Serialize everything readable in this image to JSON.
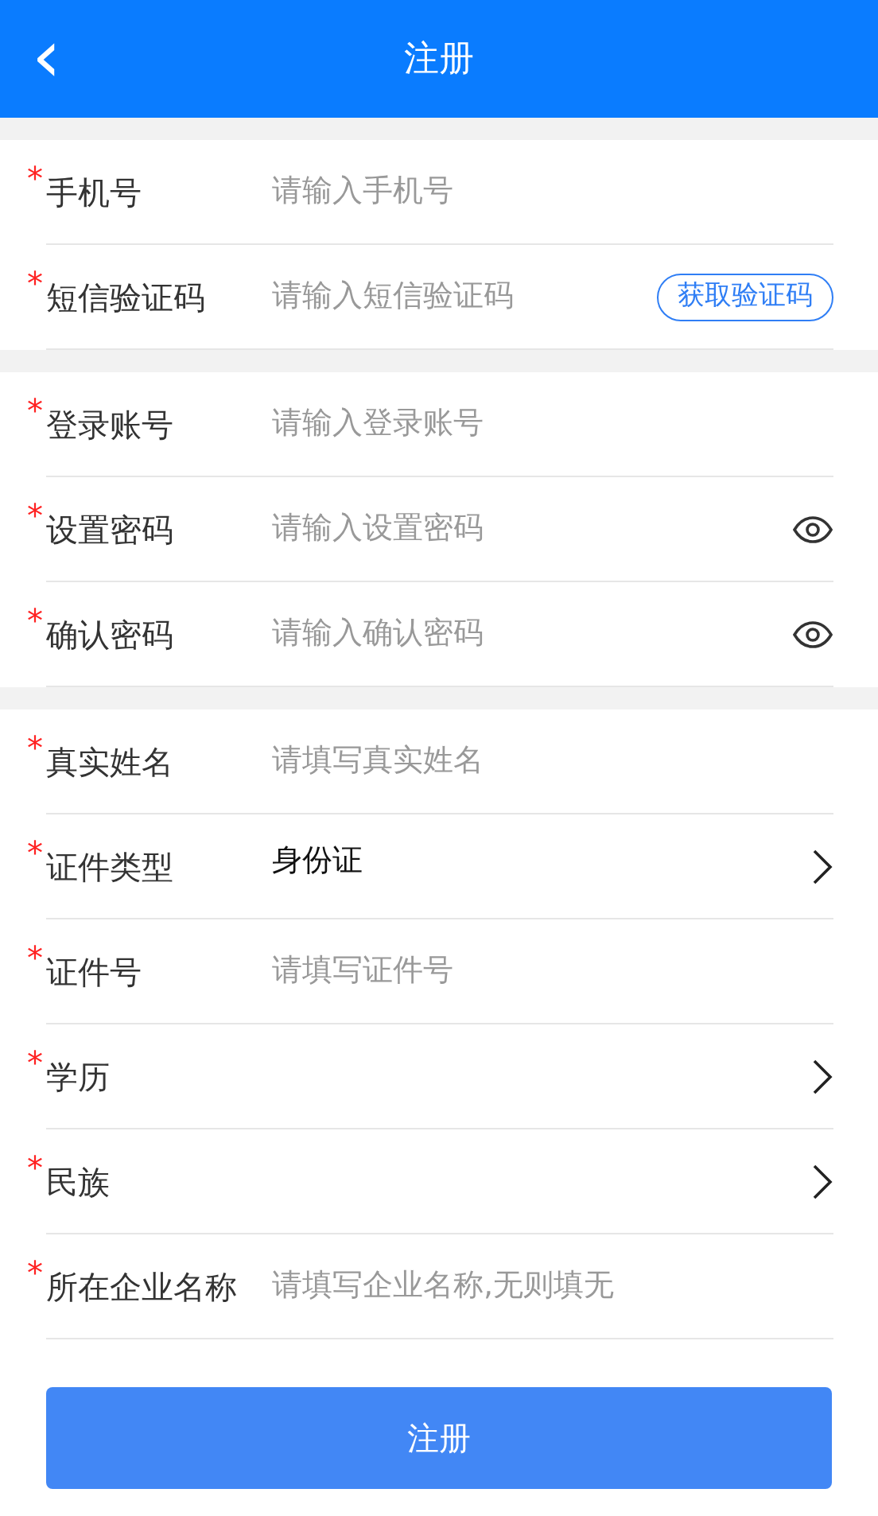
{
  "header": {
    "back": "‹",
    "title": "注册"
  },
  "sections": [
    {
      "rows": [
        {
          "kind": "input",
          "mark": "*",
          "label": "手机号",
          "placeholder": "请输入手机号"
        },
        {
          "kind": "code",
          "mark": "*",
          "label": "短信验证码",
          "placeholder": "请输入短信验证码",
          "button": "获取验证码"
        }
      ]
    },
    {
      "rows": [
        {
          "kind": "input",
          "mark": "*",
          "label": "登录账号",
          "placeholder": "请输入登录账号"
        },
        {
          "kind": "password",
          "mark": "*",
          "label": "设置密码",
          "placeholder": "请输入设置密码"
        },
        {
          "kind": "password",
          "mark": "*",
          "label": "确认密码",
          "placeholder": "请输入确认密码"
        }
      ]
    },
    {
      "rows": [
        {
          "kind": "input",
          "mark": "*",
          "label": "真实姓名",
          "placeholder": "请填写真实姓名"
        },
        {
          "kind": "select",
          "mark": "*",
          "label": "证件类型",
          "value": "身份证"
        },
        {
          "kind": "input",
          "mark": "*",
          "label": "证件号",
          "placeholder": "请填写证件号"
        },
        {
          "kind": "select",
          "mark": "*",
          "label": "学历"
        },
        {
          "kind": "select",
          "mark": "*",
          "label": "民族"
        },
        {
          "kind": "input",
          "mark": "*",
          "label": "所在企业名称",
          "placeholder": "请填写企业名称,无则填无"
        }
      ]
    }
  ],
  "submit": "注册"
}
